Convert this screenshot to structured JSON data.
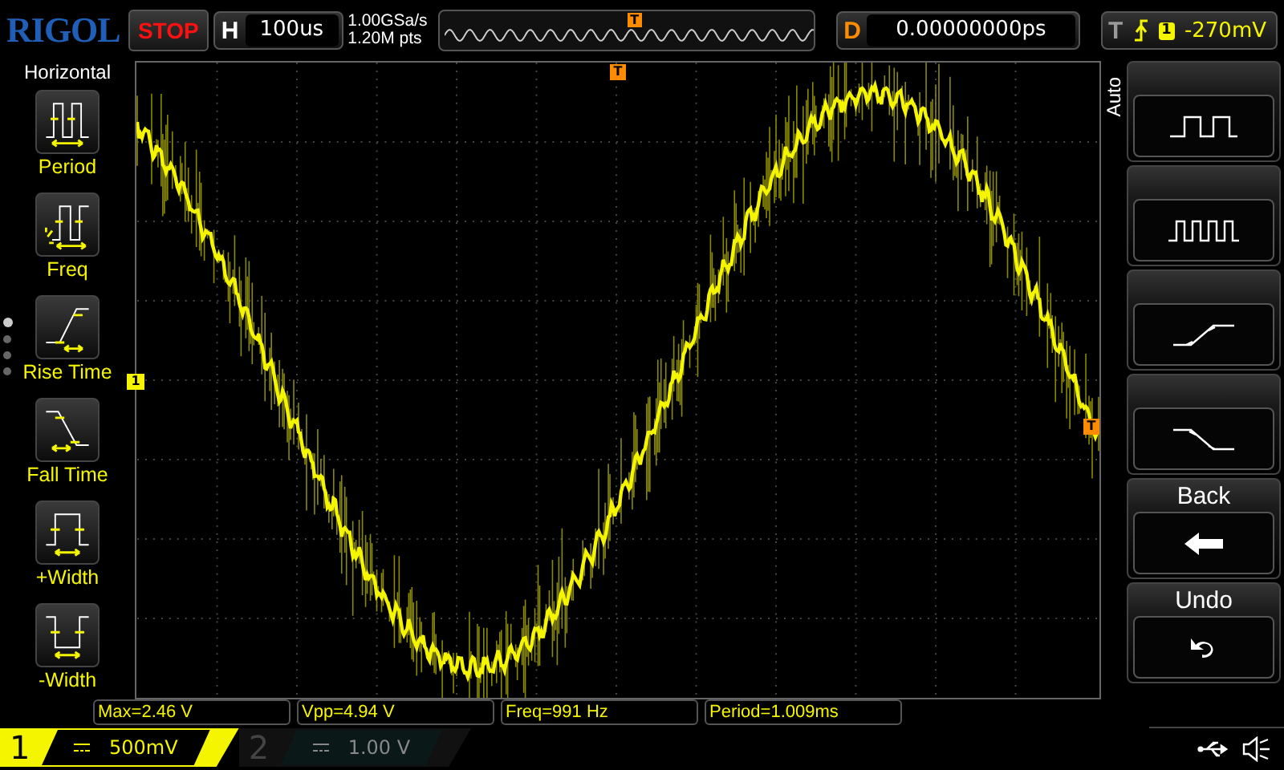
{
  "logo": "RIGOL",
  "run_state": "STOP",
  "horizontal": {
    "label": "H",
    "timebase": "100us"
  },
  "sample": {
    "rate": "1.00GSa/s",
    "depth": "1.20M pts"
  },
  "memory": {
    "marker": "T"
  },
  "delay": {
    "label": "D",
    "value": "0.00000000ps"
  },
  "trigger": {
    "label": "T",
    "source": "1",
    "level": "-270mV"
  },
  "left_menu": {
    "title": "Horizontal",
    "items": [
      {
        "kind": "period",
        "label": "Period"
      },
      {
        "kind": "freq",
        "label": "Freq"
      },
      {
        "kind": "rise",
        "label": "Rise Time"
      },
      {
        "kind": "fall",
        "label": "Fall Time"
      },
      {
        "kind": "pwidth",
        "label": "+Width"
      },
      {
        "kind": "nwidth",
        "label": "-Width"
      }
    ],
    "pages": [
      {
        "selected": true
      },
      {
        "selected": false
      },
      {
        "selected": false
      },
      {
        "selected": false
      }
    ]
  },
  "markers": {
    "trigger_position": "T",
    "channel_ground": "1",
    "trigger_level": "T"
  },
  "right_menu": {
    "side_label": "Auto",
    "items": [
      {
        "kind": "pulse"
      },
      {
        "kind": "pulses"
      },
      {
        "kind": "rise"
      },
      {
        "kind": "fall"
      },
      {
        "kind": "back",
        "title": "Back"
      },
      {
        "kind": "undo",
        "title": "Undo"
      }
    ]
  },
  "measurements": [
    "Max=2.46 V",
    "Vpp=4.94 V",
    "Freq=991 Hz",
    "Period=1.009ms"
  ],
  "channels": [
    {
      "number": "1",
      "scale": "500mV",
      "selected": true
    },
    {
      "number": "2",
      "scale": "1.00 V",
      "selected": false
    }
  ]
}
